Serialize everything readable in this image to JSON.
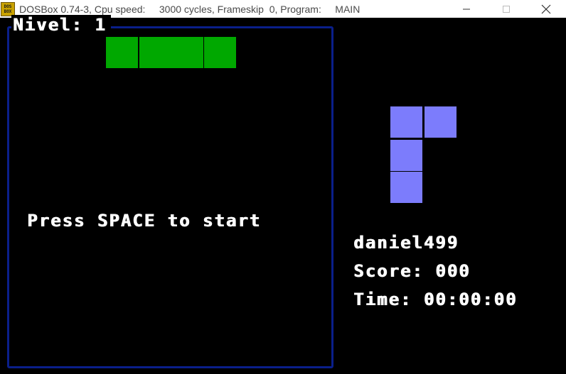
{
  "window": {
    "title": "DOSBox 0.74-3, Cpu speed:     3000 cycles, Frameskip  0, Program:     MAIN",
    "icon_text": [
      "DOS",
      "BOX"
    ],
    "icon": "dosbox-icon",
    "controls": [
      "minimize-icon",
      "maximize-icon",
      "close-icon"
    ]
  },
  "game": {
    "level_label": "Nivel: 1",
    "start_message": "Press SPACE to start",
    "player_name": "daniel499",
    "score_label": "Score: 000",
    "time_label": "Time: 00:00:00"
  },
  "colors": {
    "border": "#0a1f8a",
    "current_piece": "#00a800",
    "next_piece": "#7c7cfc",
    "background": "#000000",
    "text": "#ffffff"
  },
  "pieces": {
    "current": {
      "type": "I",
      "color": "#00a800",
      "orientation": "horizontal",
      "cells": 4
    },
    "next": {
      "type": "L",
      "color": "#7c7cfc",
      "orientation": "vertical",
      "cells": 4
    }
  }
}
